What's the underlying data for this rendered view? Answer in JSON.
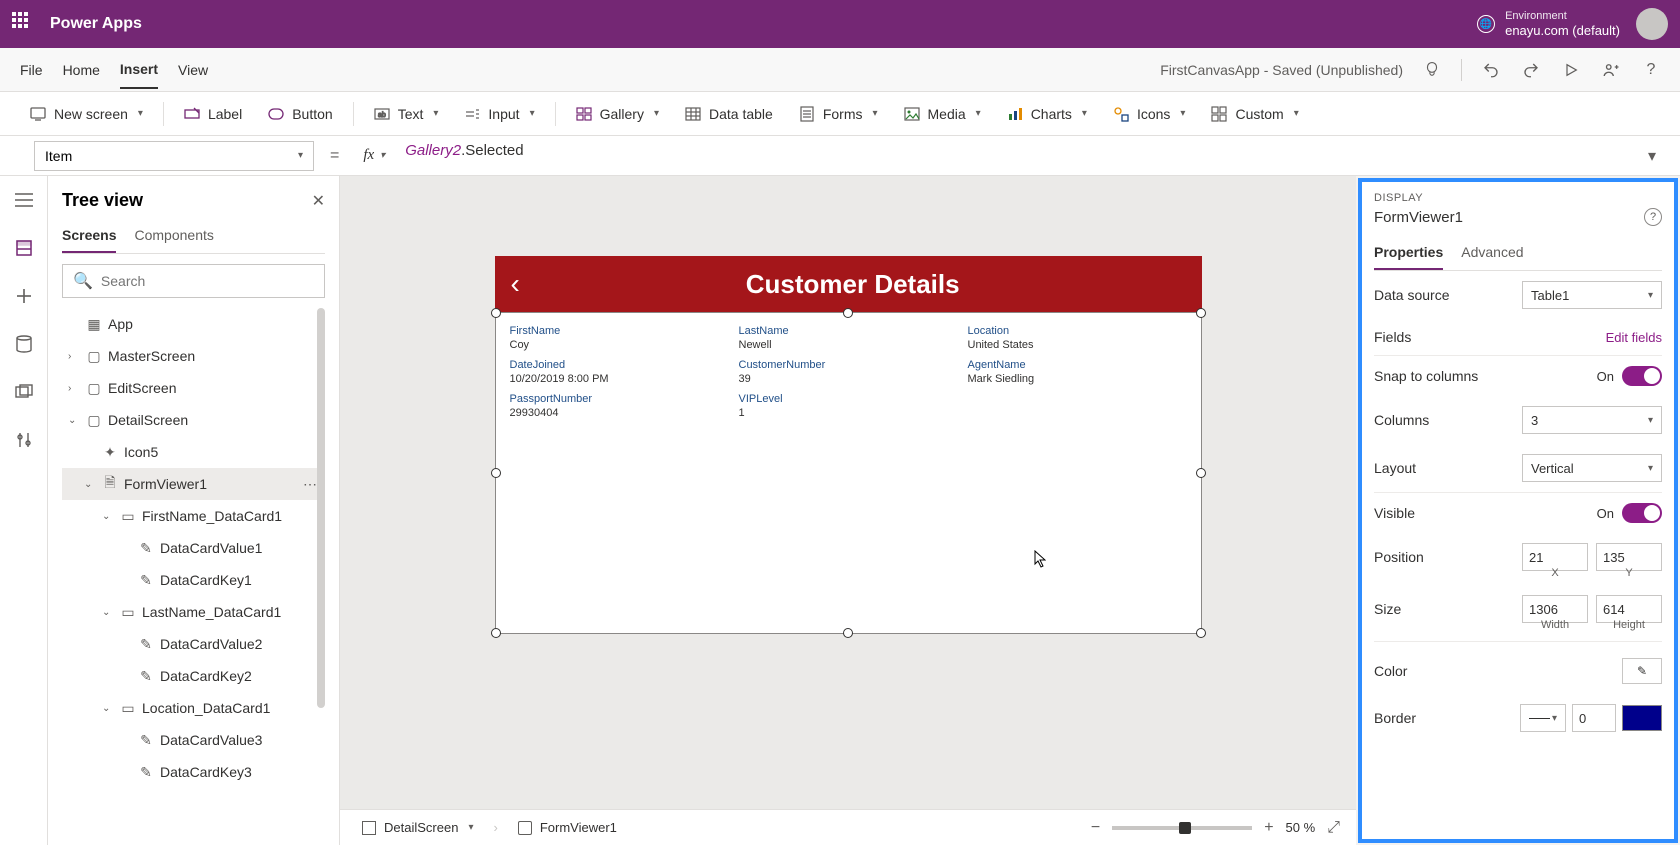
{
  "brand": "Power Apps",
  "environment": {
    "label": "Environment",
    "name": "enayu.com (default)"
  },
  "menus": {
    "file": "File",
    "home": "Home",
    "insert": "Insert",
    "view": "View"
  },
  "appStatus": "FirstCanvasApp - Saved (Unpublished)",
  "ribbon": {
    "newScreen": "New screen",
    "label": "Label",
    "button": "Button",
    "text": "Text",
    "input": "Input",
    "gallery": "Gallery",
    "dataTable": "Data table",
    "forms": "Forms",
    "media": "Media",
    "charts": "Charts",
    "icons": "Icons",
    "custom": "Custom"
  },
  "formulaBar": {
    "property": "Item",
    "formulaPart1": "Gallery2",
    "formulaPart2": ".Selected"
  },
  "treeView": {
    "title": "Tree view",
    "tabs": {
      "screens": "Screens",
      "components": "Components"
    },
    "searchPlaceholder": "Search",
    "nodes": {
      "app": "App",
      "master": "MasterScreen",
      "edit": "EditScreen",
      "detail": "DetailScreen",
      "icon5": "Icon5",
      "formViewer": "FormViewer1",
      "fnCard": "FirstName_DataCard1",
      "dcv1": "DataCardValue1",
      "dck1": "DataCardKey1",
      "lnCard": "LastName_DataCard1",
      "dcv2": "DataCardValue2",
      "dck2": "DataCardKey2",
      "locCard": "Location_DataCard1",
      "dcv3": "DataCardValue3",
      "dck3": "DataCardKey3"
    }
  },
  "canvas": {
    "screenTitle": "Customer Details",
    "fields": [
      {
        "label": "FirstName",
        "value": "Coy"
      },
      {
        "label": "LastName",
        "value": "Newell"
      },
      {
        "label": "Location",
        "value": "United States"
      },
      {
        "label": "DateJoined",
        "value": "10/20/2019 8:00 PM"
      },
      {
        "label": "CustomerNumber",
        "value": "39"
      },
      {
        "label": "AgentName",
        "value": "Mark Siedling"
      },
      {
        "label": "PassportNumber",
        "value": "29930404"
      },
      {
        "label": "VIPLevel",
        "value": "1"
      }
    ]
  },
  "props": {
    "sectionLabel": "DISPLAY",
    "elementName": "FormViewer1",
    "tabs": {
      "properties": "Properties",
      "advanced": "Advanced"
    },
    "dataSource": {
      "label": "Data source",
      "value": "Table1"
    },
    "fields": {
      "label": "Fields",
      "link": "Edit fields"
    },
    "snap": {
      "label": "Snap to columns",
      "state": "On"
    },
    "columns": {
      "label": "Columns",
      "value": "3"
    },
    "layout": {
      "label": "Layout",
      "value": "Vertical"
    },
    "visible": {
      "label": "Visible",
      "state": "On"
    },
    "position": {
      "label": "Position",
      "x": "21",
      "y": "135",
      "xLabel": "X",
      "yLabel": "Y"
    },
    "size": {
      "label": "Size",
      "w": "1306",
      "h": "614",
      "wLabel": "Width",
      "hLabel": "Height"
    },
    "color": {
      "label": "Color"
    },
    "border": {
      "label": "Border",
      "value": "0"
    }
  },
  "bottomBar": {
    "screen": "DetailScreen",
    "element": "FormViewer1",
    "zoom": "50 %"
  }
}
